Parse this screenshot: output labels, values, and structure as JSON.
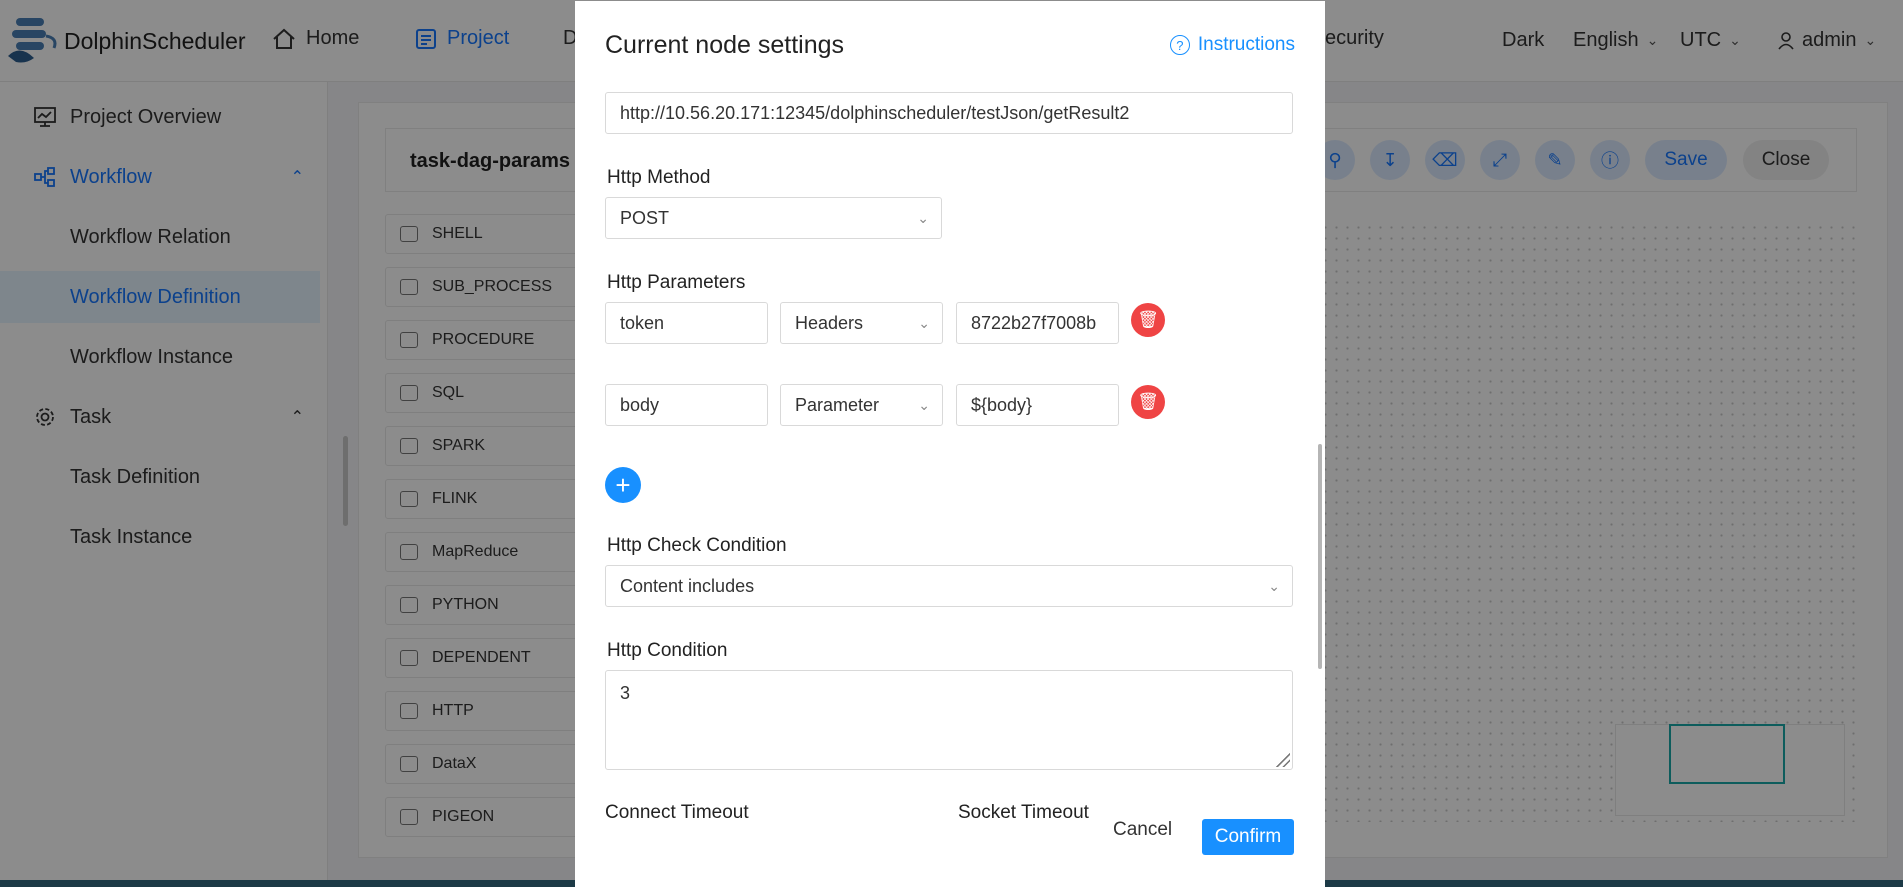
{
  "header": {
    "brand": "DolphinScheduler",
    "nav": [
      "Home",
      "Project",
      "D",
      "ecurity"
    ],
    "theme": "Dark",
    "language": "English",
    "timezone": "UTC",
    "user": "admin"
  },
  "sidebar": {
    "items": [
      {
        "label": "Project Overview"
      },
      {
        "label": "Workflow"
      },
      {
        "label": "Workflow Relation"
      },
      {
        "label": "Workflow Definition"
      },
      {
        "label": "Workflow Instance"
      },
      {
        "label": "Task"
      },
      {
        "label": "Task Definition"
      },
      {
        "label": "Task Instance"
      }
    ]
  },
  "workflow": {
    "title": "task-dag-params",
    "tasks": [
      "SHELL",
      "SUB_PROCESS",
      "PROCEDURE",
      "SQL",
      "SPARK",
      "FLINK",
      "MapReduce",
      "PYTHON",
      "DEPENDENT",
      "HTTP",
      "DataX",
      "PIGEON"
    ],
    "save": "Save",
    "close": "Close"
  },
  "modal": {
    "title": "Current node settings",
    "instructions": "Instructions",
    "url": "http://10.56.20.171:12345/dolphinscheduler/testJson/getResult2",
    "method_label": "Http Method",
    "method": "POST",
    "params_label": "Http Parameters",
    "params": [
      {
        "prop": "token",
        "type": "Headers",
        "value": "8722b27f7008b"
      },
      {
        "prop": "body",
        "type": "Parameter",
        "value": "${body}"
      }
    ],
    "check_label": "Http Check Condition",
    "check": "Content includes",
    "condition_label": "Http Condition",
    "condition": "3",
    "connect_timeout": "Connect Timeout",
    "socket_timeout": "Socket Timeout",
    "cancel": "Cancel",
    "confirm": "Confirm"
  },
  "colors": {
    "accent": "#1890ff",
    "danger": "#ef4444",
    "overlay": "rgba(0,0,0,0.45)"
  }
}
